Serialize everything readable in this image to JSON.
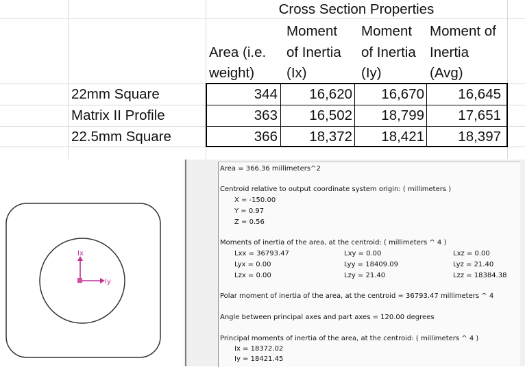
{
  "spreadsheet": {
    "title": "Cross Section Properties",
    "headers": {
      "area": [
        "Area (i.e.",
        "weight)"
      ],
      "ix": [
        "Moment",
        "of Inertia",
        "(Ix)"
      ],
      "iy": [
        "Moment",
        "of Inertia",
        "(Iy)"
      ],
      "avg": [
        "Moment of",
        "Inertia",
        "(Avg)"
      ]
    },
    "rows": [
      {
        "label": "22mm Square",
        "area": "344",
        "ix": "16,620",
        "iy": "16,670",
        "avg": "16,645"
      },
      {
        "label": "Matrix II Profile",
        "area": "363",
        "ix": "16,502",
        "iy": "18,799",
        "avg": "17,651"
      },
      {
        "label": "22.5mm Square",
        "area": "366",
        "ix": "18,372",
        "iy": "18,421",
        "avg": "18,397"
      }
    ]
  },
  "properties": {
    "area": "Area = 366.36 millimeters^2",
    "centroid_title": "Centroid relative to output coordinate system origin: ( millimeters )",
    "x": "X = -150.00",
    "y": "Y = 0.97",
    "z": "Z = 0.56",
    "moments_title": "Moments of inertia of the area, at the centroid: ( millimeters ^ 4 )",
    "lxx": "Lxx = 36793.47",
    "lxy": "Lxy = 0.00",
    "lxz": "Lxz = 0.00",
    "lyx": "Lyx = 0.00",
    "lyy": "Lyy = 18409.09",
    "lyz": "Lyz = 21.40",
    "lzx": "Lzx = 0.00",
    "lzy": "Lzy = 21.40",
    "lzz": "Lzz = 18384.38",
    "polar": "Polar moment of inertia of the area, at the centroid = 36793.47 millimeters ^ 4",
    "angle": "Angle between principal axes and part axes = 120.00 degrees",
    "principal_title": "Principal moments of inertia of the area, at the centroid: ( millimeters ^ 4 )",
    "ix": "Ix = 18372.02",
    "iy": "Iy = 18421.45"
  },
  "drawing": {
    "axis_x_label": "Iy",
    "axis_y_label": "Ix",
    "axis_color": "#c03090"
  }
}
